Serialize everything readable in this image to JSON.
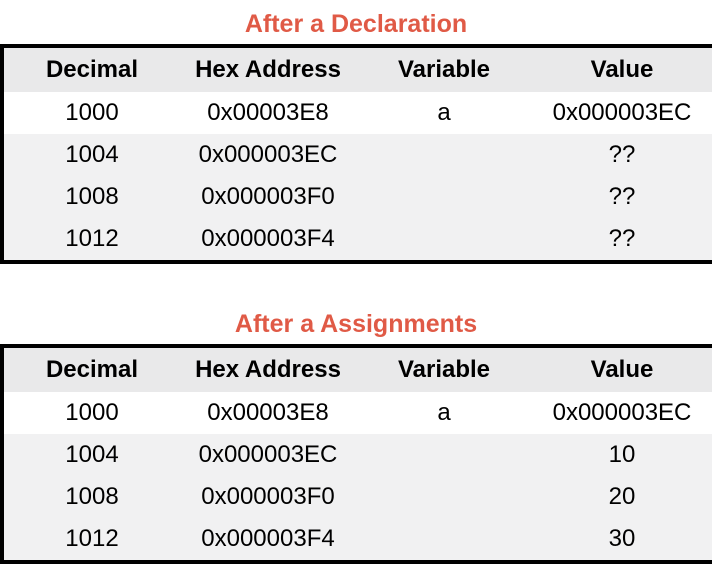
{
  "headers": {
    "decimal": "Decimal",
    "hex": "Hex Address",
    "variable": "Variable",
    "value": "Value"
  },
  "tables": [
    {
      "title": "After a Declaration",
      "rows": [
        {
          "decimal": "1000",
          "hex": "0x00003E8",
          "variable": "a",
          "value": "0x000003EC"
        },
        {
          "decimal": "1004",
          "hex": "0x000003EC",
          "variable": "",
          "value": "??"
        },
        {
          "decimal": "1008",
          "hex": "0x000003F0",
          "variable": "",
          "value": "??"
        },
        {
          "decimal": "1012",
          "hex": "0x000003F4",
          "variable": "",
          "value": "??"
        }
      ]
    },
    {
      "title": "After a Assignments",
      "rows": [
        {
          "decimal": "1000",
          "hex": "0x00003E8",
          "variable": "a",
          "value": "0x000003EC"
        },
        {
          "decimal": "1004",
          "hex": "0x000003EC",
          "variable": "",
          "value": "10"
        },
        {
          "decimal": "1008",
          "hex": "0x000003F0",
          "variable": "",
          "value": "20"
        },
        {
          "decimal": "1012",
          "hex": "0x000003F4",
          "variable": "",
          "value": "30"
        }
      ]
    }
  ],
  "colors": {
    "title": "#e05a46",
    "header_bg": "#e9e9ea",
    "row_white": "#ffffff",
    "row_gray": "#f1f1f2",
    "border": "#000000"
  }
}
